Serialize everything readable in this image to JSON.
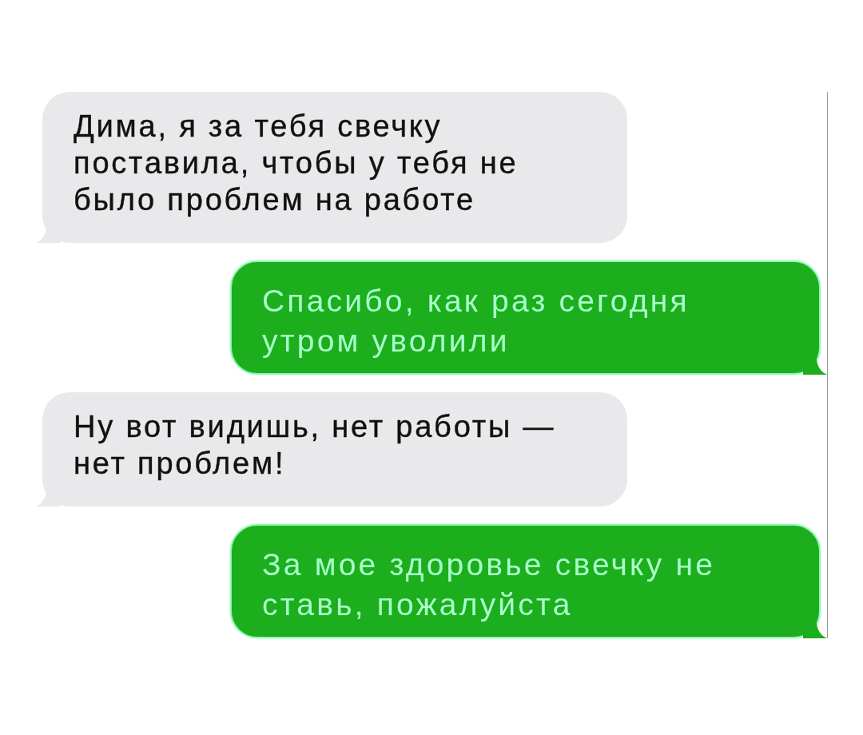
{
  "messages": [
    {
      "kind": "incoming",
      "text": "Дима, я за тебя свечку\nпоставила, чтобы у тебя не\nбыло проблем на работе"
    },
    {
      "kind": "outgoing",
      "text": "Спасибо, как раз сегодня\nутром уволили"
    },
    {
      "kind": "incoming",
      "text": "Ну вот видишь, нет работы —\nнет проблем!"
    },
    {
      "kind": "outgoing",
      "text": "За мое здоровье свечку не\nставь, пожалуйста"
    }
  ]
}
